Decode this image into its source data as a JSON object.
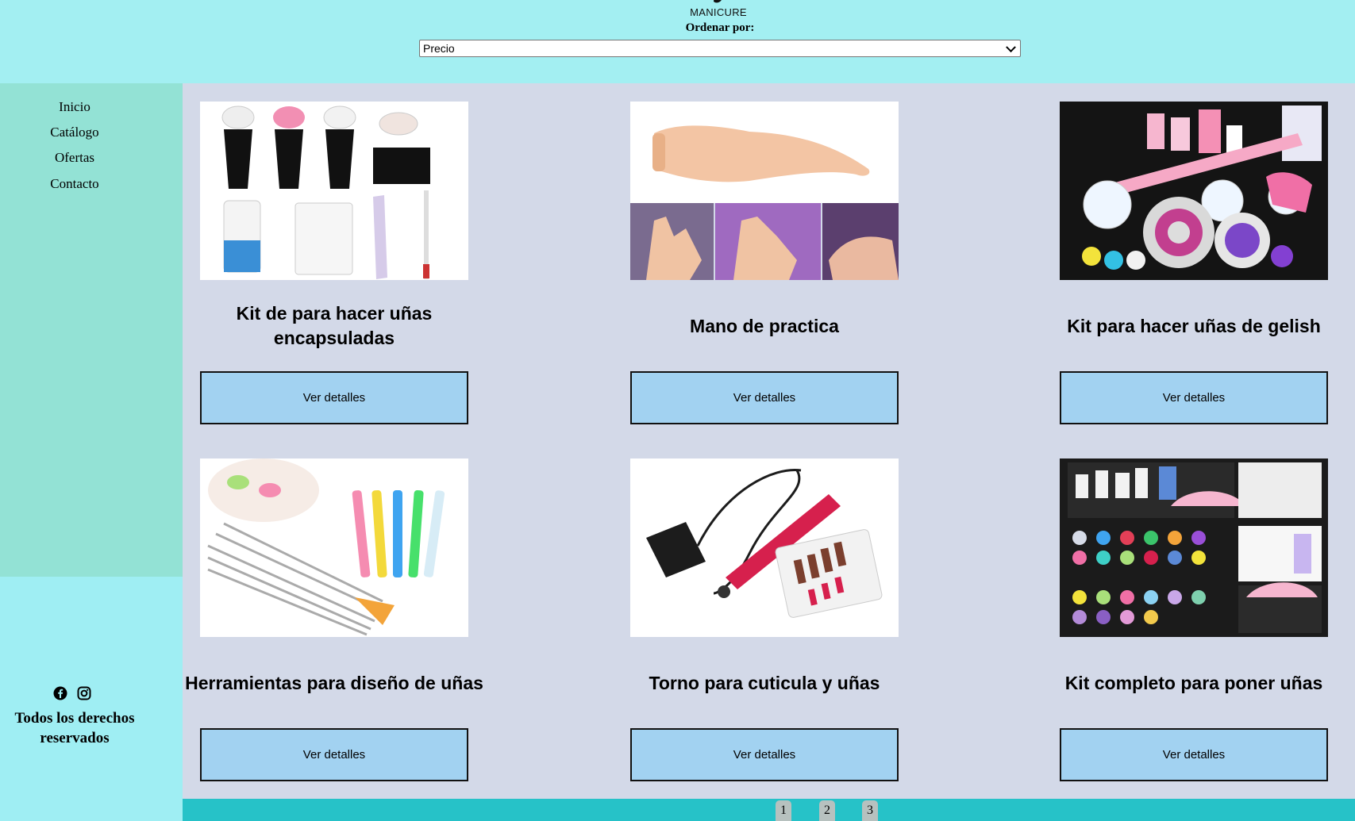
{
  "header": {
    "logo_text": "MANICURE",
    "sort_label": "Ordenar por:",
    "sort_selected": "Precio"
  },
  "sidebar": {
    "items": [
      {
        "label": "Inicio"
      },
      {
        "label": "Catálogo"
      },
      {
        "label": "Ofertas"
      },
      {
        "label": "Contacto"
      }
    ]
  },
  "footer": {
    "social_icons": [
      "facebook-icon",
      "instagram-icon"
    ],
    "rights": "Todos los derechos reservados"
  },
  "products": [
    {
      "title": "Kit de para hacer uñas encapsuladas",
      "button": "Ver detalles"
    },
    {
      "title": "Mano de practica",
      "button": "Ver detalles"
    },
    {
      "title": "Kit para hacer uñas de gelish",
      "button": "Ver detalles"
    },
    {
      "title": "Herramientas para diseño de uñas",
      "button": "Ver detalles"
    },
    {
      "title": "Torno para cuticula y uñas",
      "button": "Ver detalles"
    },
    {
      "title": "Kit completo para poner uñas",
      "button": "Ver detalles"
    }
  ],
  "pagination": [
    "1",
    "2",
    "3"
  ],
  "colors": {
    "header_bg": "#a3eff2",
    "sidebar_bg": "#93e2d5",
    "content_bg": "#d3d9e8",
    "button_bg": "#a2d2f1",
    "pager_bg": "#26c2c8"
  }
}
